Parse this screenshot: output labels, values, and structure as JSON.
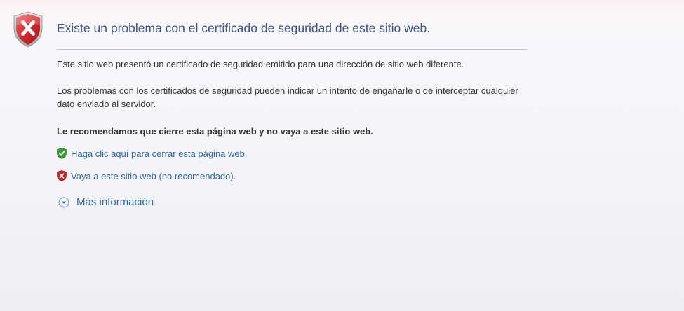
{
  "page": {
    "title": "Existe un problema con el certificado de seguridad de este sitio web.",
    "paragraph1": "Este sitio web presentó un certificado de seguridad emitido para una dirección de sitio web diferente.",
    "paragraph2": "Los problemas con los certificados de seguridad pueden indicar un intento de engañarle o de interceptar cualquier dato enviado al servidor.",
    "recommendation": "Le recomendamos que cierre esta página web y no vaya a este sitio web."
  },
  "links": {
    "close_page": "Haga clic aquí para cerrar esta página web.",
    "continue_site": "Vaya a este sitio web (no recomendado).",
    "more_info": "Más información"
  },
  "icons": {
    "header": "error-shield-icon",
    "close_page": "green-check-shield-icon",
    "continue_site": "red-x-shield-icon",
    "more_info": "expand-chevron-icon"
  },
  "colors": {
    "title": "#3d5487",
    "link": "#2e69a8",
    "error_red": "#c8232b",
    "safe_green": "#3c9a3c"
  }
}
